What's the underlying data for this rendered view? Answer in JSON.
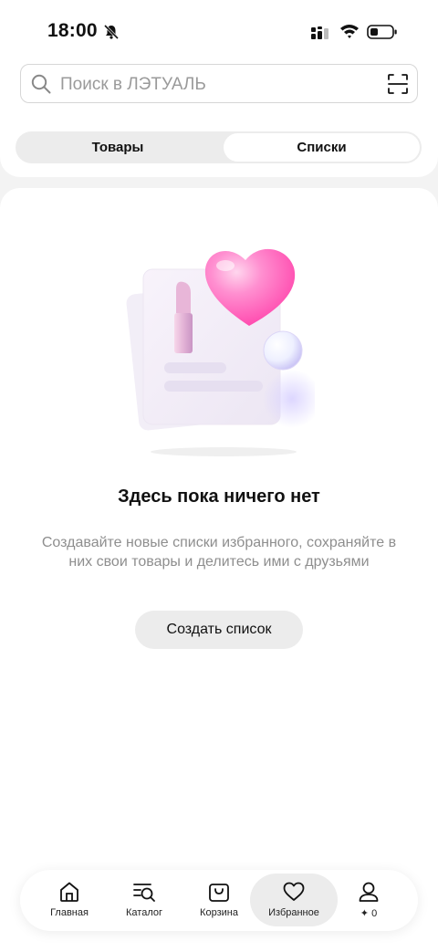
{
  "status_bar": {
    "time": "18:00"
  },
  "search": {
    "placeholder": "Поиск в ЛЭТУАЛЬ"
  },
  "tabs": [
    {
      "label": "Товары",
      "selected": false
    },
    {
      "label": "Списки",
      "selected": true
    }
  ],
  "empty_state": {
    "title": "Здесь пока ничего нет",
    "description": "Создавайте новые списки избранного, сохраняйте в них свои товары и делитесь ими с друзьями",
    "button_label": "Создать список"
  },
  "bottom_nav": {
    "items": [
      {
        "label": "Главная",
        "icon": "home-icon"
      },
      {
        "label": "Каталог",
        "icon": "catalog-icon"
      },
      {
        "label": "Корзина",
        "icon": "cart-icon"
      },
      {
        "label": "Избранное",
        "icon": "heart-icon",
        "active": true
      },
      {
        "label": "✦ 0",
        "icon": "profile-icon"
      }
    ]
  },
  "colors": {
    "accent_pink": "#ff5fb0",
    "background": "#f3f3f3"
  }
}
